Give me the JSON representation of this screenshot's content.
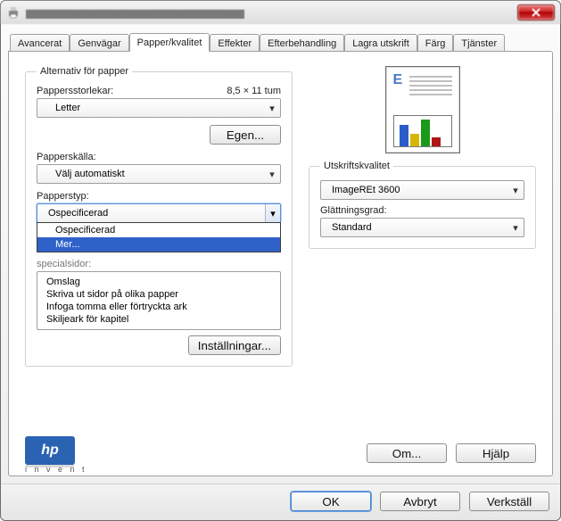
{
  "tabs": {
    "advanced": "Avancerat",
    "shortcuts": "Genvägar",
    "paper_quality": "Papper/kvalitet",
    "effects": "Effekter",
    "finishing": "Efterbehandling",
    "job_storage": "Lagra utskrift",
    "color": "Färg",
    "services": "Tjänster"
  },
  "paper": {
    "group_label": "Alternativ för papper",
    "sizes_label": "Pappersstorlekar:",
    "size_hint": "8,5 × 11 tum",
    "size_value": "Letter",
    "custom_btn": "Egen...",
    "source_label": "Papperskälla:",
    "source_value": "Välj automatiskt",
    "type_label": "Papperstyp:",
    "type_value": "Ospecificerad",
    "type_options": {
      "o1": "Ospecificerad",
      "o2": "Mer..."
    },
    "special_label_obscured": "specialsidor:",
    "special_items": {
      "i1": "Omslag",
      "i2": "Skriva ut sidor på olika papper",
      "i3": "Infoga tomma eller förtryckta ark",
      "i4": "Skiljeark för kapitel"
    },
    "settings_btn": "Inställningar..."
  },
  "quality": {
    "group_label": "Utskriftskvalitet",
    "resolution_value": "ImageREt 3600",
    "gloss_label": "Glättningsgrad:",
    "gloss_value": "Standard"
  },
  "logo": {
    "text": "hp",
    "tagline": "i n v e n t"
  },
  "inner_buttons": {
    "about": "Om...",
    "help": "Hjälp"
  },
  "dialog_buttons": {
    "ok": "OK",
    "cancel": "Avbryt",
    "apply": "Verkställ"
  }
}
